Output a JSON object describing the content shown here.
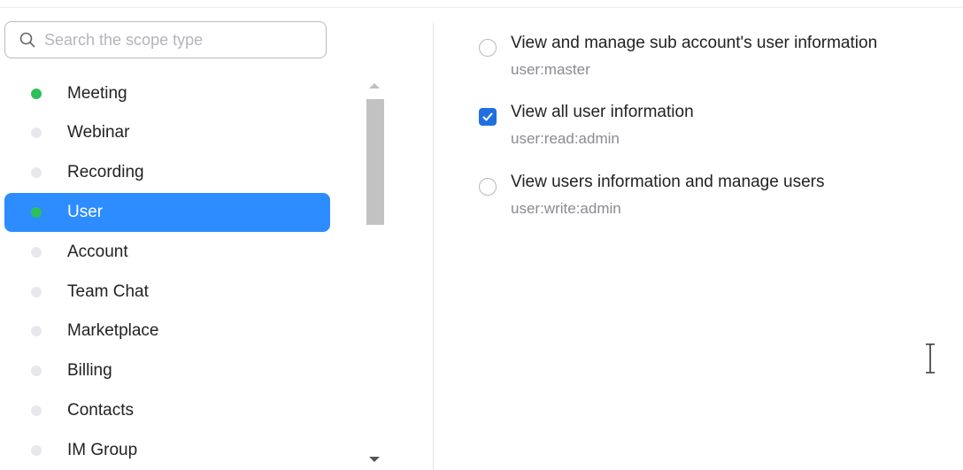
{
  "search": {
    "placeholder": "Search the scope type"
  },
  "scopes": [
    {
      "label": "Meeting",
      "active": true
    },
    {
      "label": "Webinar",
      "active": false
    },
    {
      "label": "Recording",
      "active": false
    },
    {
      "label": "User",
      "active": true,
      "selected": true
    },
    {
      "label": "Account",
      "active": false
    },
    {
      "label": "Team Chat",
      "active": false
    },
    {
      "label": "Marketplace",
      "active": false
    },
    {
      "label": "Billing",
      "active": false
    },
    {
      "label": "Contacts",
      "active": false
    },
    {
      "label": "IM Group",
      "active": false
    }
  ],
  "permissions": [
    {
      "title": "View and manage sub account's user information",
      "scope": "user:master",
      "checked": false
    },
    {
      "title": "View all user information",
      "scope": "user:read:admin",
      "checked": true
    },
    {
      "title": "View users information and manage users",
      "scope": "user:write:admin",
      "checked": false
    }
  ],
  "colors": {
    "accent": "#2D8CFF",
    "active_dot": "#2cc05a",
    "checkbox_checked": "#1f6fe0"
  },
  "icons": {
    "search": "search-icon",
    "cursor": "text-cursor-icon"
  }
}
